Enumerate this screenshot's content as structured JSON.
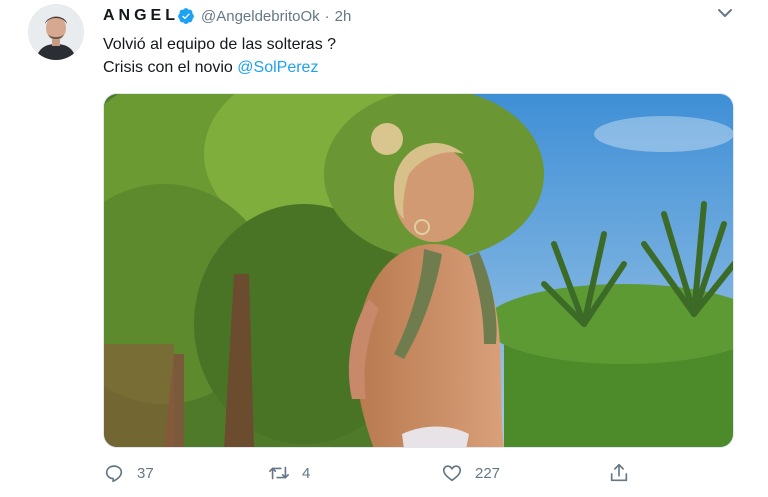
{
  "author": {
    "display_name": "ANGEL",
    "handle": "@AngeldebritoOk",
    "separator": "·",
    "time": "2h"
  },
  "tweet": {
    "line1": "Volvió al equipo de las solteras ?",
    "line2_prefix": "Crisis con el novio ",
    "mention": "@SolPerez"
  },
  "actions": {
    "reply_count": "37",
    "retweet_count": "4",
    "like_count": "227"
  },
  "icons": [
    "verified-badge-icon",
    "chevron-down-icon",
    "reply-icon",
    "retweet-icon",
    "like-icon",
    "share-icon"
  ],
  "colors": {
    "accent": "#1da1f2",
    "muted": "#657786",
    "text": "#14171a"
  }
}
